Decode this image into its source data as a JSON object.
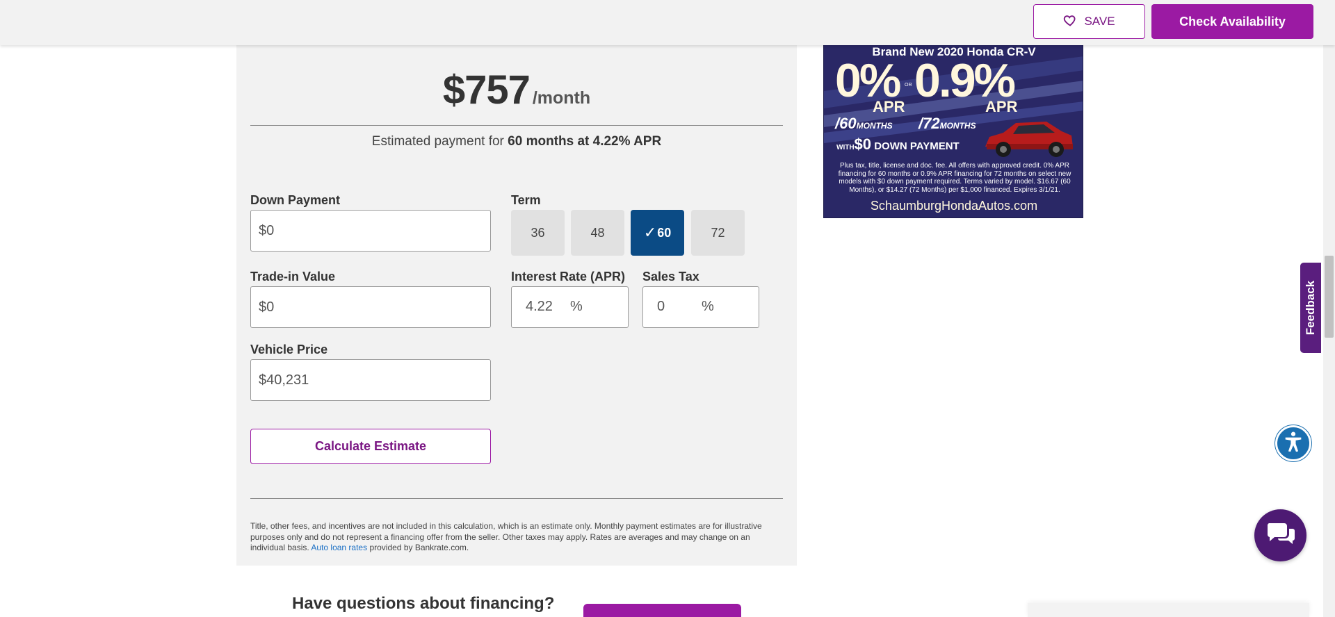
{
  "header": {
    "save_label": "SAVE",
    "check_label": "Check Availability"
  },
  "calculator": {
    "amount": "$757",
    "per": "/month",
    "estimate_prefix": "Estimated payment for",
    "estimate_bold": "60 months at 4.22% APR",
    "down_payment": {
      "label": "Down Payment",
      "value": "$0"
    },
    "term": {
      "label": "Term",
      "options": [
        "36",
        "48",
        "60",
        "72"
      ],
      "selected": "60"
    },
    "trade_in": {
      "label": "Trade-in Value",
      "value": "$0"
    },
    "interest": {
      "label": "Interest Rate (APR)",
      "value": "4.22",
      "unit": "%"
    },
    "sales_tax": {
      "label": "Sales Tax",
      "value": "0",
      "unit": "%"
    },
    "vehicle_price": {
      "label": "Vehicle Price",
      "value": "$40,231"
    },
    "calculate_label": "Calculate Estimate",
    "disclaimer_text": "Title, other fees, and incentives are not included in this calculation, which is an estimate only. Monthly payment estimates are for illustrative purposes only and do not represent a financing offer from the seller. Other taxes may apply. Rates are averages and may change on an individual basis.",
    "disclaimer_link": "Auto loan rates",
    "disclaimer_suffix": "provided by Bankrate.com."
  },
  "ad": {
    "headline": "Brand New 2020 Honda CR-V",
    "rate1": "0%",
    "apr1": "APR",
    "or": "OR",
    "rate2": "0.9%",
    "apr2": "APR",
    "months60": "/60",
    "months60_suffix": "MONTHS",
    "months72": "/72",
    "months72_suffix": "MONTHS",
    "down_prefix": "WITH",
    "down_amount": "$0",
    "down_suffix": "DOWN PAYMENT",
    "fine_print": "Plus tax, title, license and doc. fee. All offers with approved credit. 0% APR financing for 60 months or 0.9% APR financing for 72 months on select new models with $0 down payment required. Terms varied by model. $16.67 (60 Months), or $14.27 (72 Months) per $1,000 financed. Expires 3/1/21.",
    "site": "SchaumburgHondaAutos.com"
  },
  "side": {
    "feedback_label": "Feedback"
  },
  "bottom": {
    "questions": "Have questions about financing?"
  },
  "colors": {
    "brand_purple": "#9b1aa3",
    "term_selected": "#0b4b85",
    "chat_purple": "#4d1a73",
    "access_blue": "#1a6fb0"
  }
}
